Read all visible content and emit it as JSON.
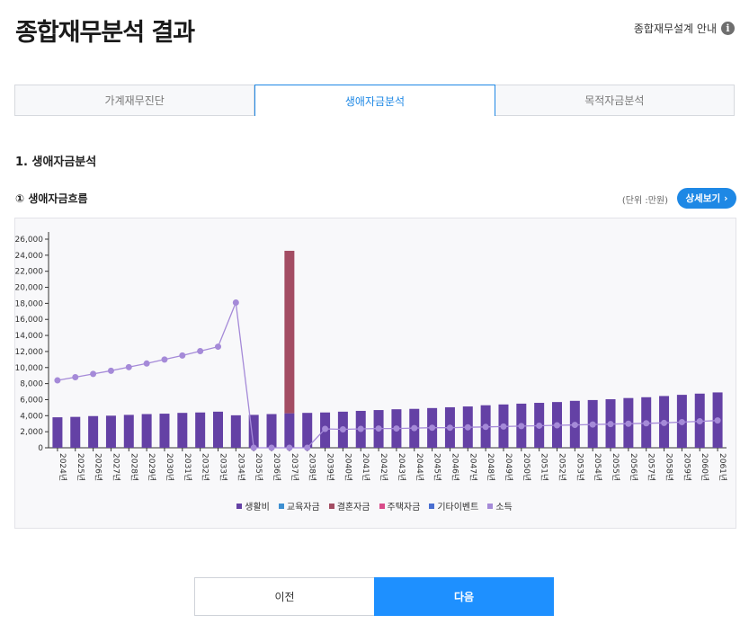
{
  "header": {
    "title": "종합재무분석 결과",
    "guide_label": "종합재무설계 안내",
    "guide_icon": "info-icon"
  },
  "tabs": [
    {
      "label": "가계재무진단",
      "active": false
    },
    {
      "label": "생애자금분석",
      "active": true
    },
    {
      "label": "목적자금분석",
      "active": false
    }
  ],
  "section": {
    "title": "1. 생애자금분석",
    "subtitle": "① 생애자금흐름",
    "unit": "(단위 :만원)",
    "detail_button": "상세보기"
  },
  "colors": {
    "living": "#6441a5",
    "education": "#3d8fd1",
    "marriage": "#a34d63",
    "housing": "#d94c8a",
    "event": "#4a6fd1",
    "income": "#a58ad8",
    "accent": "#1e88e5"
  },
  "chart_data": {
    "type": "bar",
    "ylim": [
      0,
      26000
    ],
    "yticks": [
      "0",
      "2,000",
      "4,000",
      "6,000",
      "8,000",
      "10,000",
      "12,000",
      "14,000",
      "16,000",
      "18,000",
      "20,000",
      "22,000",
      "24,000",
      "26,000"
    ],
    "ytick_values": [
      0,
      2000,
      4000,
      6000,
      8000,
      10000,
      12000,
      14000,
      16000,
      18000,
      20000,
      22000,
      24000,
      26000
    ],
    "categories": [
      "2024년",
      "2025년",
      "2026년",
      "2027년",
      "2028년",
      "2029년",
      "2030년",
      "2031년",
      "2032년",
      "2033년",
      "2034년",
      "2035년",
      "2036년",
      "2037년",
      "2038년",
      "2039년",
      "2040년",
      "2041년",
      "2042년",
      "2043년",
      "2044년",
      "2045년",
      "2046년",
      "2047년",
      "2048년",
      "2049년",
      "2050년",
      "2051년",
      "2052년",
      "2053년",
      "2054년",
      "2055년",
      "2056년",
      "2057년",
      "2058년",
      "2059년",
      "2060년",
      "2061년"
    ],
    "series": [
      {
        "name": "생활비",
        "kind": "bar",
        "color": "#6441a5",
        "values": [
          3800,
          3850,
          3950,
          4000,
          4100,
          4200,
          4250,
          4350,
          4400,
          4500,
          4050,
          4100,
          4200,
          4300,
          4350,
          4400,
          4500,
          4600,
          4700,
          4800,
          4850,
          4950,
          5050,
          5150,
          5300,
          5400,
          5500,
          5600,
          5700,
          5850,
          5950,
          6050,
          6200,
          6300,
          6450,
          6600,
          6750,
          6900
        ]
      },
      {
        "name": "교육자금",
        "kind": "bar",
        "color": "#3d8fd1",
        "values": [
          0,
          0,
          0,
          0,
          0,
          0,
          0,
          0,
          0,
          0,
          0,
          0,
          0,
          0,
          0,
          0,
          0,
          0,
          0,
          0,
          0,
          0,
          0,
          0,
          0,
          0,
          0,
          0,
          0,
          0,
          0,
          0,
          0,
          0,
          0,
          0,
          0,
          0
        ]
      },
      {
        "name": "결혼자금",
        "kind": "bar",
        "color": "#a34d63",
        "values": [
          0,
          0,
          0,
          0,
          0,
          0,
          0,
          0,
          0,
          0,
          0,
          0,
          0,
          20250,
          0,
          0,
          0,
          0,
          0,
          0,
          0,
          0,
          0,
          0,
          0,
          0,
          0,
          0,
          0,
          0,
          0,
          0,
          0,
          0,
          0,
          0,
          0,
          0
        ]
      },
      {
        "name": "주택자금",
        "kind": "bar",
        "color": "#d94c8a",
        "values": [
          0,
          0,
          0,
          0,
          0,
          0,
          0,
          0,
          0,
          0,
          0,
          0,
          0,
          0,
          0,
          0,
          0,
          0,
          0,
          0,
          0,
          0,
          0,
          0,
          0,
          0,
          0,
          0,
          0,
          0,
          0,
          0,
          0,
          0,
          0,
          0,
          0,
          0
        ]
      },
      {
        "name": "기타이벤트",
        "kind": "bar",
        "color": "#4a6fd1",
        "values": [
          0,
          0,
          0,
          0,
          0,
          0,
          0,
          0,
          0,
          0,
          0,
          0,
          0,
          0,
          0,
          0,
          0,
          0,
          0,
          0,
          0,
          0,
          0,
          0,
          0,
          0,
          0,
          0,
          0,
          0,
          0,
          0,
          0,
          0,
          0,
          0,
          0,
          0
        ]
      },
      {
        "name": "소득",
        "kind": "line",
        "color": "#a58ad8",
        "values": [
          8400,
          8800,
          9200,
          9600,
          10050,
          10500,
          11000,
          11500,
          12050,
          12600,
          18100,
          0,
          0,
          0,
          0,
          2350,
          2300,
          2350,
          2400,
          2400,
          2450,
          2500,
          2500,
          2550,
          2600,
          2650,
          2700,
          2750,
          2800,
          2850,
          2900,
          2950,
          3000,
          3050,
          3100,
          3200,
          3300,
          3400
        ]
      }
    ]
  },
  "buttons": {
    "prev": "이전",
    "next": "다음"
  }
}
